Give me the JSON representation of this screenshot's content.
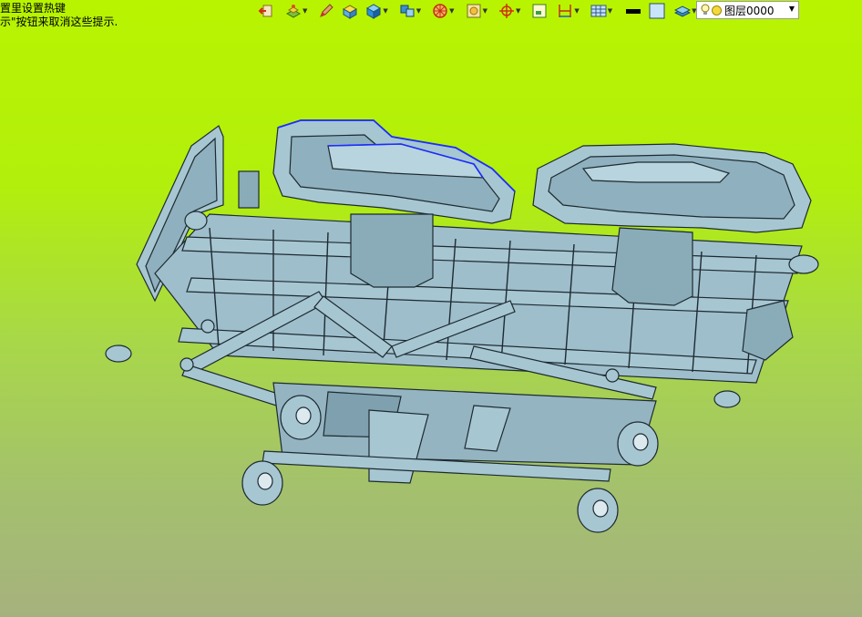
{
  "hint": {
    "line1": "置里设置热键",
    "line2": "示\"按钮来取消这些提示."
  },
  "toolbar": {
    "buttons": [
      {
        "name": "exit-icon",
        "arrow": false
      },
      {
        "name": "layer-stack-icon",
        "arrow": true
      },
      {
        "name": "pencil-icon",
        "arrow": false
      },
      {
        "name": "cube-yellow-icon",
        "arrow": false
      },
      {
        "name": "cube-blue-icon",
        "arrow": true
      },
      {
        "name": "multi-cube-icon",
        "arrow": true
      },
      {
        "name": "section-wheel-icon",
        "arrow": true
      },
      {
        "name": "render-box-icon",
        "arrow": true
      },
      {
        "name": "snap-target-icon",
        "arrow": true
      },
      {
        "name": "frame-icon",
        "arrow": false
      },
      {
        "name": "dimension-icon",
        "arrow": true
      },
      {
        "name": "table-icon",
        "arrow": true
      },
      {
        "name": "line-color-icon",
        "arrow": false
      },
      {
        "name": "fill-color-icon",
        "arrow": false
      },
      {
        "name": "layer-icon",
        "arrow": true
      }
    ],
    "layer_name": "图层0000"
  },
  "colors": {
    "model_fill": "#a6c6d2",
    "model_stroke": "#1e2a30",
    "selection": "#1a2cff"
  }
}
